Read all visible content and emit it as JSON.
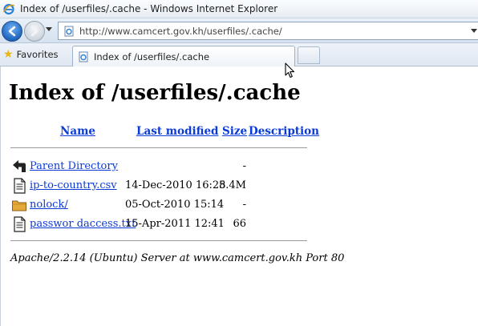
{
  "window": {
    "title": "Index of /userfiles/.cache - Windows Internet Explorer"
  },
  "navigation": {
    "url": "http://www.camcert.gov.kh/userfiles/.cache/"
  },
  "tabs": {
    "favorites_label": "Favorites",
    "active_tab_label": "Index of /userfiles/.cache"
  },
  "page": {
    "heading": "Index of /userfiles/.cache",
    "columns": {
      "name": "Name",
      "last_modified": "Last modified",
      "size": "Size",
      "description": "Description"
    },
    "rows": [
      {
        "icon": "parent-directory-icon",
        "name": "Parent Directory",
        "modified": "",
        "size": "-"
      },
      {
        "icon": "text-file-icon",
        "name": "ip-to-country.csv",
        "modified": "14-Dec-2010 16:28",
        "size": "5.4M"
      },
      {
        "icon": "folder-icon",
        "name": "nolock/",
        "modified": "05-Oct-2010 15:14",
        "size": "-"
      },
      {
        "icon": "text-file-icon",
        "name": "passwor daccess.txt",
        "modified": "15-Apr-2011 12:41",
        "size": "66"
      }
    ],
    "server_signature": "Apache/2.2.14 (Ubuntu) Server at www.camcert.gov.kh Port 80"
  }
}
